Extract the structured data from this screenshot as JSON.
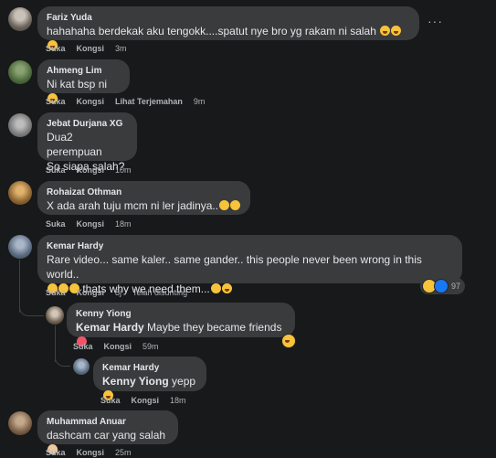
{
  "labels": {
    "like": "Suka",
    "share": "Kongsi",
    "translate": "Lihat Terjemahan",
    "edited": "Telah disunting"
  },
  "comments": [
    {
      "name": "Fariz Yuda",
      "text": "hahahaha berdekak aku tengokk....spatut nye bro yg rakam ni salah",
      "time": "3m"
    },
    {
      "name": "Ahmeng Lim",
      "text": "Ni kat bsp ni",
      "time": "9m"
    },
    {
      "name": "Jebat Durjana XG",
      "text_line1": "Dua2 perempuan",
      "text_line2": "So siapa salah?",
      "time": "10m"
    },
    {
      "name": "Rohaizat Othman",
      "text": "X ada arah tuju mcm ni ler jadinya..",
      "time": "18m"
    },
    {
      "name": "Kemar Hardy",
      "text_line1": "Rare video... same kaler.. same gander.. this people never been wrong in this world..",
      "text_line2": "thats why we need them...",
      "time": "8j",
      "reaction_count": "97"
    },
    {
      "name": "Kenny Yiong",
      "mention": "Kemar Hardy",
      "text": "Maybe they became friends",
      "time": "59m"
    },
    {
      "name": "Kemar Hardy",
      "mention": "Kenny Yiong",
      "text": "yepp",
      "time": "18m"
    },
    {
      "name": "Muhammad Anuar",
      "text": "dashcam car yang salah",
      "time": "25m"
    }
  ],
  "colors": {
    "background": "#18191a",
    "bubble": "#3a3b3c",
    "text": "#e4e6eb",
    "muted": "#b0b3b8"
  }
}
